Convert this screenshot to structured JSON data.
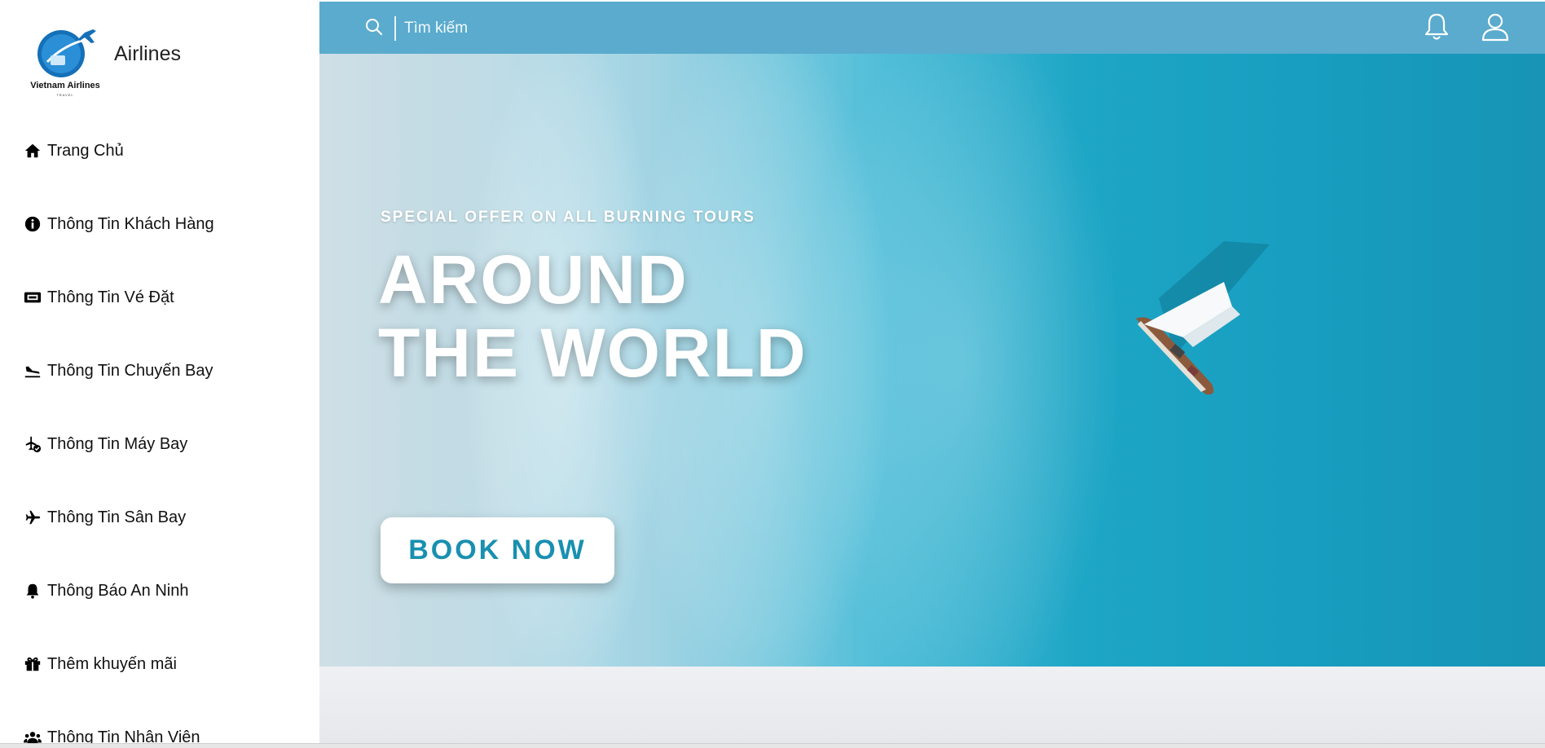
{
  "sidebar": {
    "brand": {
      "logo_text": "Vietnam Airlines",
      "logo_subtext": "TRAVEL",
      "name": "Airlines"
    },
    "items": [
      {
        "label": "Trang Chủ",
        "icon": "home-icon"
      },
      {
        "label": "Thông Tin Khách Hàng",
        "icon": "info-circle-icon"
      },
      {
        "label": "Thông Tin Vé Đặt",
        "icon": "ticket-icon"
      },
      {
        "label": "Thông Tin Chuyến Bay",
        "icon": "plane-arrival-icon"
      },
      {
        "label": "Thông Tin Máy Bay",
        "icon": "plane-check-icon"
      },
      {
        "label": "Thông Tin Sân Bay",
        "icon": "plane-icon"
      },
      {
        "label": "Thông Báo An Ninh",
        "icon": "bell-icon"
      },
      {
        "label": "Thêm khuyến mãi",
        "icon": "gift-icon"
      },
      {
        "label": "Thông Tin Nhân Viên",
        "icon": "users-icon"
      }
    ]
  },
  "topbar": {
    "search": {
      "placeholder": "Tìm kiếm",
      "value": ""
    },
    "icons": [
      "search-icon",
      "bell-icon",
      "user-icon"
    ]
  },
  "hero": {
    "kicker": "SPECIAL OFFER ON ALL BURNING TOURS",
    "headline": "AROUND THE WORLD",
    "cta_label": "BOOK NOW"
  },
  "colors": {
    "topbar": "#5aabcd",
    "cta_text": "#1990b0",
    "ocean": "#1ea6c6"
  }
}
